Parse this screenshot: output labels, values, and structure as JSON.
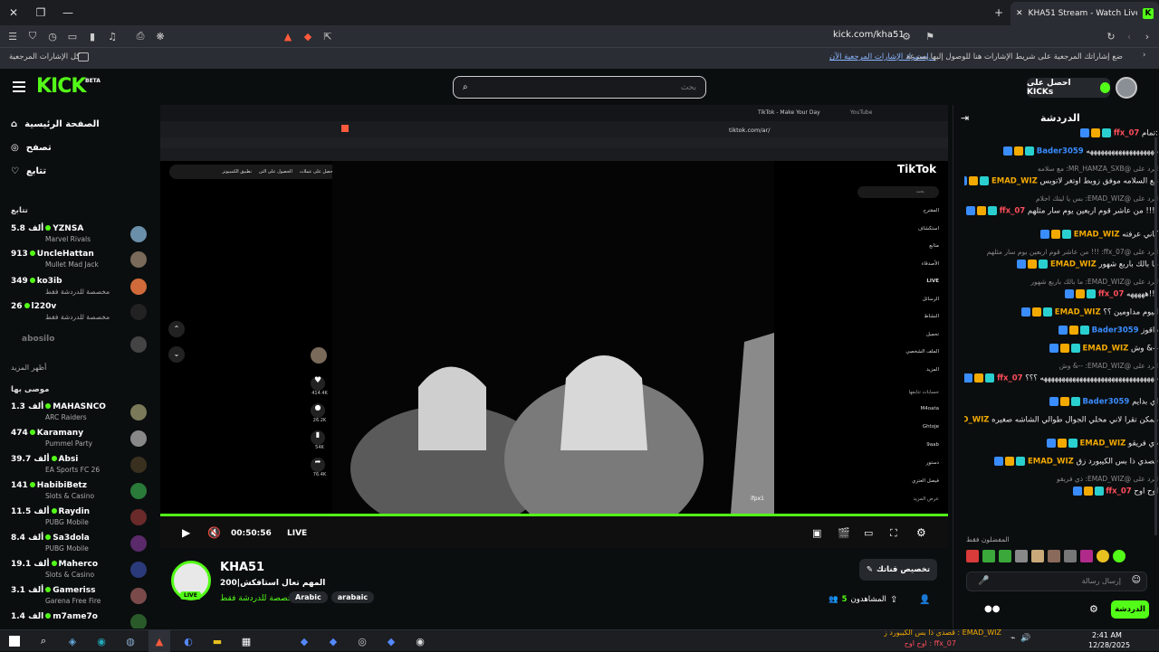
{
  "browser": {
    "tab_title": "KHA51 Stream - Watch Live on K",
    "url": "kick.com/kha51",
    "bookmarks_prompt": "ضع إشاراتك المرجعية على شريط الإشارات هنا للوصول إليها بسرعة.",
    "bookmarks_import": "إستيراد الإشارات المرجعية الآن...",
    "all_bookmarks": "كل الإشارات المرجعية"
  },
  "header": {
    "logo": "KICK",
    "beta": "BETA",
    "search_placeholder": "بحث",
    "get_kicks": "احصل على KICKs"
  },
  "sidebar": {
    "nav": [
      {
        "label": "الصفحة الرئيسية",
        "icon": "home-icon"
      },
      {
        "label": "تصفح",
        "icon": "compass-icon"
      },
      {
        "label": "تتابع",
        "icon": "heart-icon"
      }
    ],
    "following_title": "تتابع",
    "following": [
      {
        "name": "YZNSA",
        "viewers": "5.8 ألف",
        "game": "Marvel Rivals"
      },
      {
        "name": "UncleHattan",
        "viewers": "913",
        "game": "Mullet Mad Jack"
      },
      {
        "name": "ko3ib",
        "viewers": "349",
        "game": "مخصصة للدردشة فقط"
      },
      {
        "name": "l220v",
        "viewers": "26",
        "game": "مخصصة للدردشة فقط"
      },
      {
        "name": "abosilo",
        "viewers": "",
        "game": ""
      }
    ],
    "show_more": "أظهر المزيد",
    "recommended_title": "موصى بها",
    "recommended": [
      {
        "name": "MAHASNCO",
        "viewers": "1.3 ألف",
        "game": "ARC Raiders"
      },
      {
        "name": "Karamany",
        "viewers": "474",
        "game": "Pummel Party"
      },
      {
        "name": "Absi",
        "viewers": "39.7 ألف",
        "game": "EA Sports FC 26"
      },
      {
        "name": "HabibiBetz",
        "viewers": "141",
        "game": "Slots & Casino"
      },
      {
        "name": "Raydin",
        "viewers": "11.5 ألف",
        "game": "PUBG Mobile"
      },
      {
        "name": "Sa3dola",
        "viewers": "8.4 ألف",
        "game": "PUBG Mobile"
      },
      {
        "name": "Maherco",
        "viewers": "19.1 ألف",
        "game": "Slots & Casino"
      },
      {
        "name": "Gameriss",
        "viewers": "3.1 ألف",
        "game": "Garena Free Fire"
      },
      {
        "name": "m7ame7o",
        "viewers": "1.4 ألف",
        "game": ""
      }
    ]
  },
  "inner_browser": {
    "tab1": "TikTok - Make Your Day",
    "tab2": "YouTube",
    "url": "tiktok.com/ar/",
    "actions": [
      "احصل على عملات",
      "الحصول على التن",
      "تطبيق الكمبيوتر"
    ]
  },
  "tiktok": {
    "logo": "TikTok",
    "search": "بحث",
    "menu": [
      "المقترح",
      "استكشاف",
      "متابع",
      "الأصدقاء",
      "LIVE",
      "الرسائل",
      "النشاط",
      "تحميل",
      "الملف الشخصي",
      "المزيد"
    ],
    "following_accounts_title": "حسابات تتابعها",
    "accounts": [
      "M4oata",
      "Ghtoje",
      "9aab",
      "دستور",
      "فيصل العنزي"
    ],
    "see_more": "عرض المزيد",
    "likes": "414.4K",
    "comments": "26.2K",
    "saves": "54K",
    "shares": "76.4K",
    "author": "ifpx1"
  },
  "player": {
    "time": "00:50:56",
    "live": "LIVE",
    "progress_fraction": 1.0
  },
  "stream": {
    "streamer": "KHA51",
    "title": "المهم تعال استافكش|200",
    "category": "مخصصة للدردشة فقط",
    "tags": [
      "Arabic",
      "arabaic"
    ],
    "live_badge": "LIVE",
    "customize": "تخصيص قناتك",
    "viewers_label": "المشاهدون",
    "viewers": "5"
  },
  "chat": {
    "title": "الدردشة",
    "messages": [
      {
        "type": "msg",
        "user": "ffx_07",
        "color": "#ff4d5b",
        "text": ":تمام"
      },
      {
        "type": "msg",
        "user": "Bader3059",
        "color": "#3a8dff",
        "text": "هههههههههههههههههههه"
      },
      {
        "type": "reply",
        "text": "الرد على @MR_HAMZA_SXB: مع سلامه"
      },
      {
        "type": "msg",
        "user": "EMAD_WIZ",
        "color": "#f2a900",
        "text": "مع السلامه موفق زوبط اوتغر لاتوبس"
      },
      {
        "type": "reply",
        "text": "الرد على @EMAD_WIZ: بس يا ليتك احلام"
      },
      {
        "type": "msg",
        "user": "ffx_07",
        "color": "#ff4d5b",
        "text": "!!!! من عاشر قوم اربعين يوم سار مثلهم"
      },
      {
        "type": "msg",
        "user": "EMAD_WIZ",
        "color": "#f2a900",
        "text": "كاني عرفته"
      },
      {
        "type": "reply",
        "text": "الرد على @ffx_07: !!! من عاشر قوم اربعين يوم سار مثلهم"
      },
      {
        "type": "msg",
        "user": "EMAD_WIZ",
        "color": "#f2a900",
        "text": "ما بالك باربع شهور"
      },
      {
        "type": "reply",
        "text": "الرد على @EMAD_WIZ: ما بالك باربع شهور"
      },
      {
        "type": "msg",
        "user": "ffx_07",
        "color": "#ff4d5b",
        "text": "!!!هههههه"
      },
      {
        "type": "msg",
        "user": "EMAD_WIZ",
        "color": "#f2a900",
        "text": "اليوم مداومين ؟؟"
      },
      {
        "type": "msg",
        "user": "Bader3059",
        "color": "#3a8dff",
        "text": "داقوز"
      },
      {
        "type": "msg",
        "user": "EMAD_WIZ",
        "color": "#f2a900",
        "text": "--& وش"
      },
      {
        "type": "reply",
        "text": "الرد على @EMAD_WIZ: --& وش"
      },
      {
        "type": "msg",
        "user": "ffx_07",
        "color": "#ff4d5b",
        "text": "ههههههههههههههههههههههههههههههههه ؟؟؟"
      },
      {
        "type": "msg",
        "user": "Bader3059",
        "color": "#3a8dff",
        "text": "اي بدايم"
      },
      {
        "type": "msg",
        "user": "EMAD_WIZ",
        "color": "#f2a900",
        "text": "ممكن تقرا لاني مخلي الجوال طوالي الشاشه صغيره"
      },
      {
        "type": "msg",
        "user": "EMAD_WIZ",
        "color": "#f2a900",
        "text": "ذي فريقو"
      },
      {
        "type": "msg",
        "user": "EMAD_WIZ",
        "color": "#f2a900",
        "text": "قصدي ذا بس الكيبورد زق"
      },
      {
        "type": "reply",
        "text": "الرد على @EMAD_WIZ: ذي فريقو"
      },
      {
        "type": "msg",
        "user": "ffx_07",
        "color": "#ff4d5b",
        "text": "اوح اوح"
      }
    ],
    "emote_section": "المفضلون فقط",
    "input_placeholder": "إرسال رسالة",
    "send_label": "الدردشة"
  },
  "taskbar": {
    "time": "2:41 AM",
    "date": "12/28/2025",
    "toast1": "EMAD_WIZ : قصدي ذا بس الكيبورد زق",
    "toast2": "ffx_07 : اوح اوح"
  }
}
